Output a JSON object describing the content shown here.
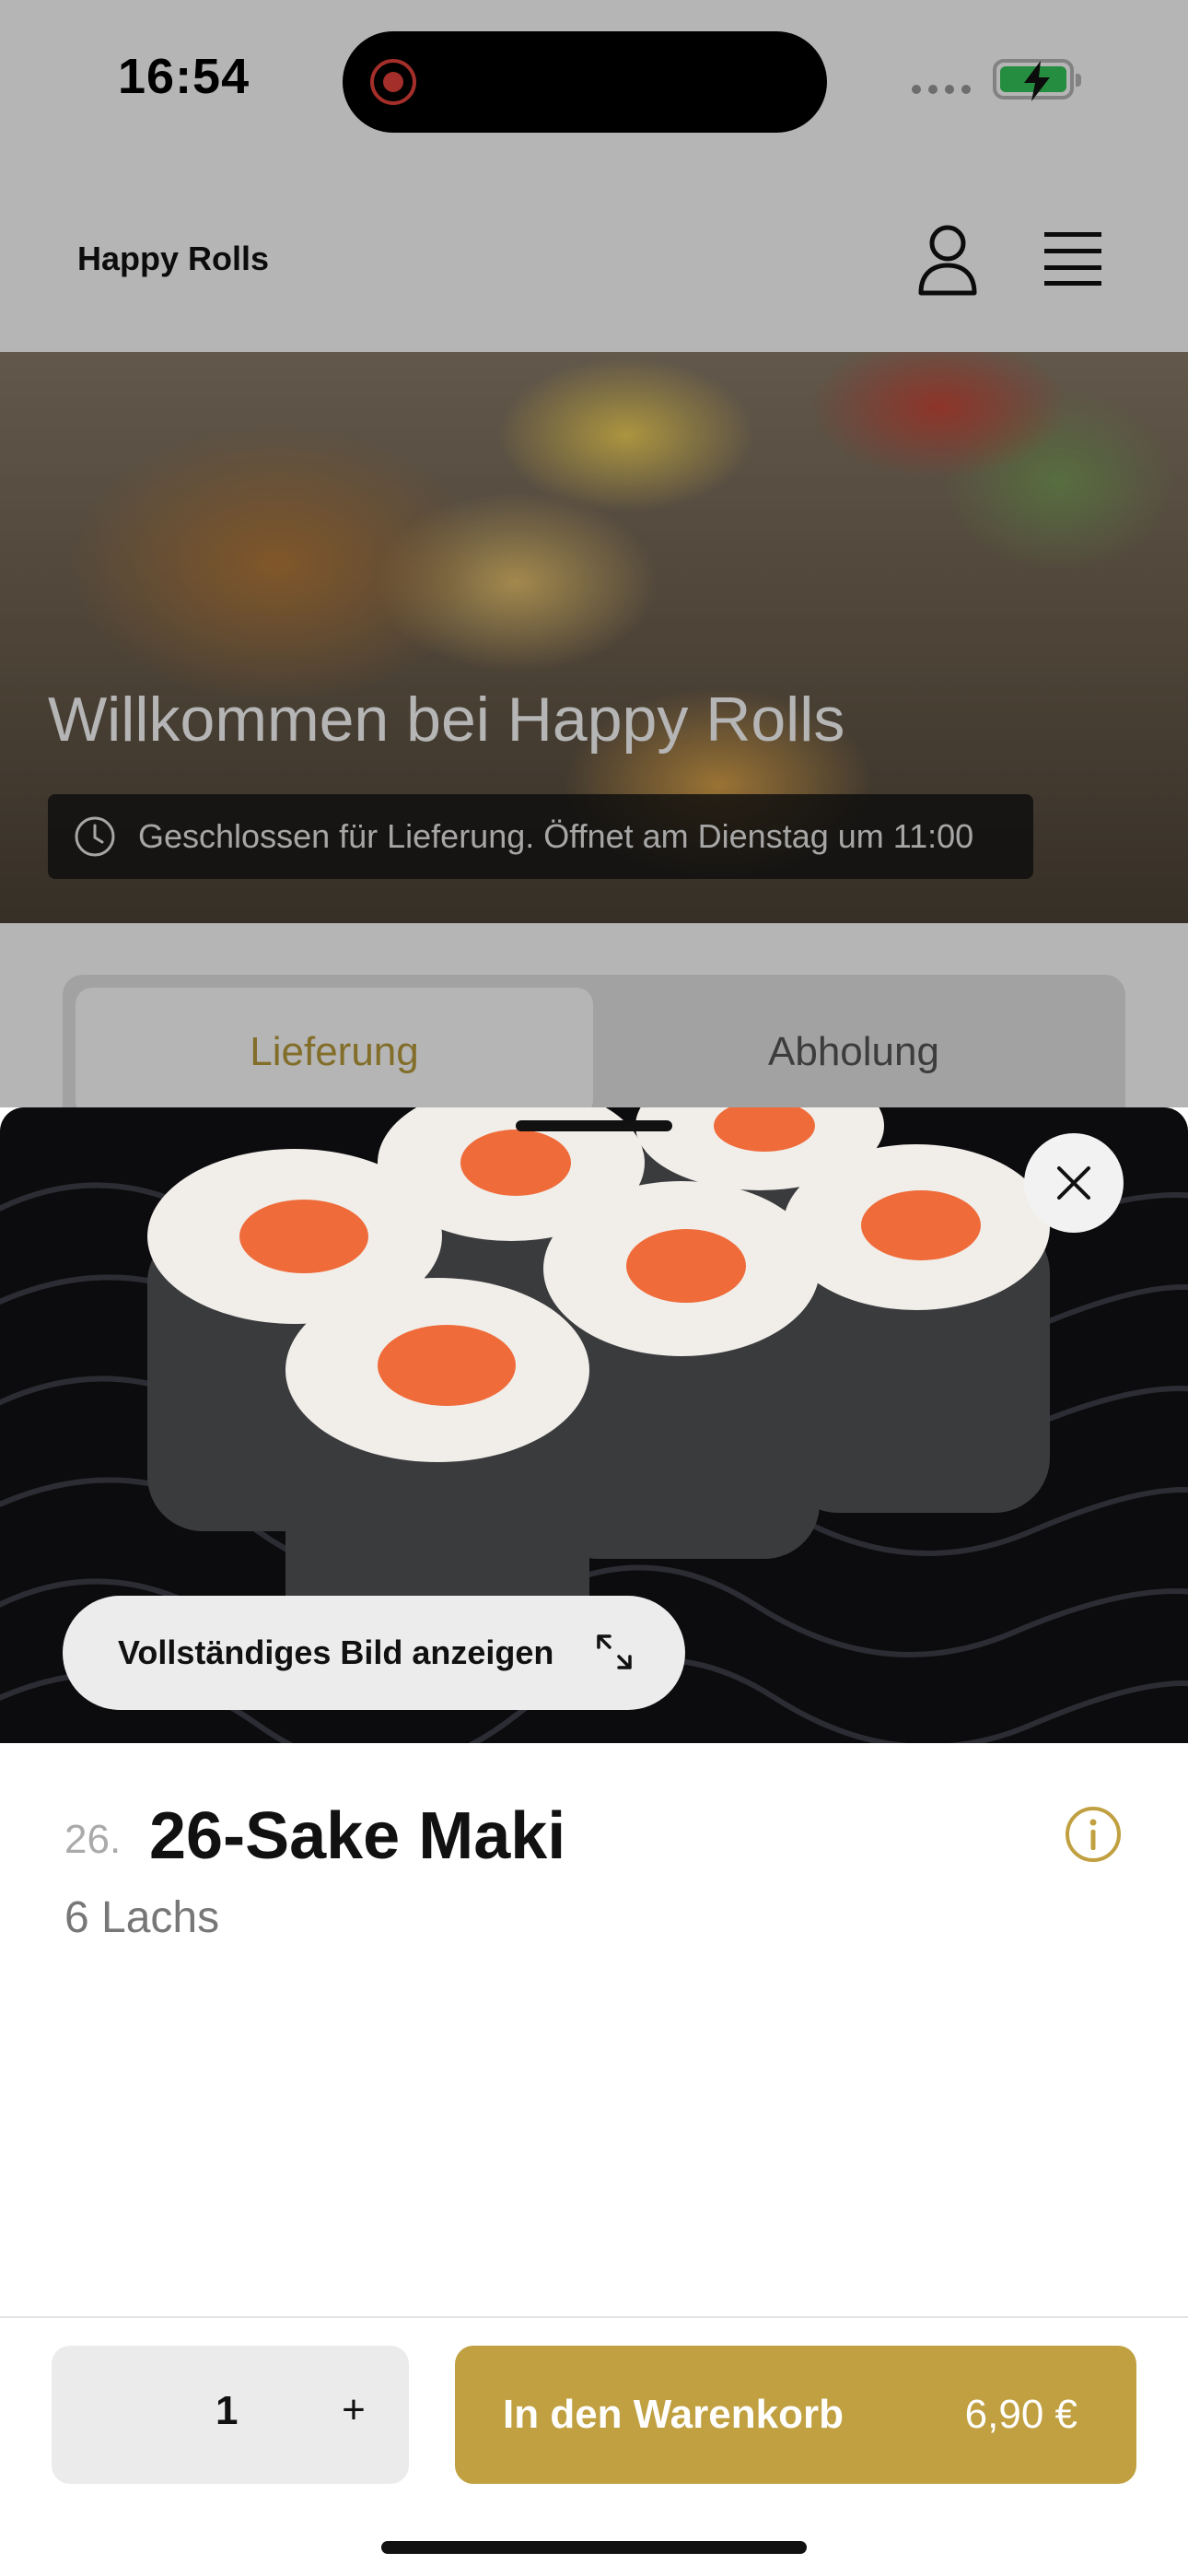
{
  "status_bar": {
    "time": "16:54"
  },
  "header": {
    "brand": "Happy Rolls"
  },
  "hero": {
    "title": "Willkommen bei Happy Rolls",
    "notice": "Geschlossen für Lieferung. Öffnet am Dienstag um 11:00"
  },
  "tabs": [
    {
      "label": "Lieferung",
      "active": true
    },
    {
      "label": "Abholung",
      "active": false
    }
  ],
  "sheet": {
    "full_image_label": "Vollständiges Bild anzeigen",
    "item_number": "26.",
    "item_name": "26-Sake Maki",
    "item_description": "6 Lachs",
    "quantity": "1",
    "plus_label": "+",
    "add_to_cart_label": "In den Warenkorb",
    "price": "6,90 €"
  },
  "colors": {
    "accent": "#c0a040",
    "tab_active_text": "#b89a3a",
    "recording": "#e8423c",
    "battery": "#35c759"
  },
  "icons": [
    "recording-icon",
    "battery-icon",
    "user-icon",
    "menu-icon",
    "clock-icon",
    "close-icon",
    "expand-icon",
    "info-icon"
  ]
}
